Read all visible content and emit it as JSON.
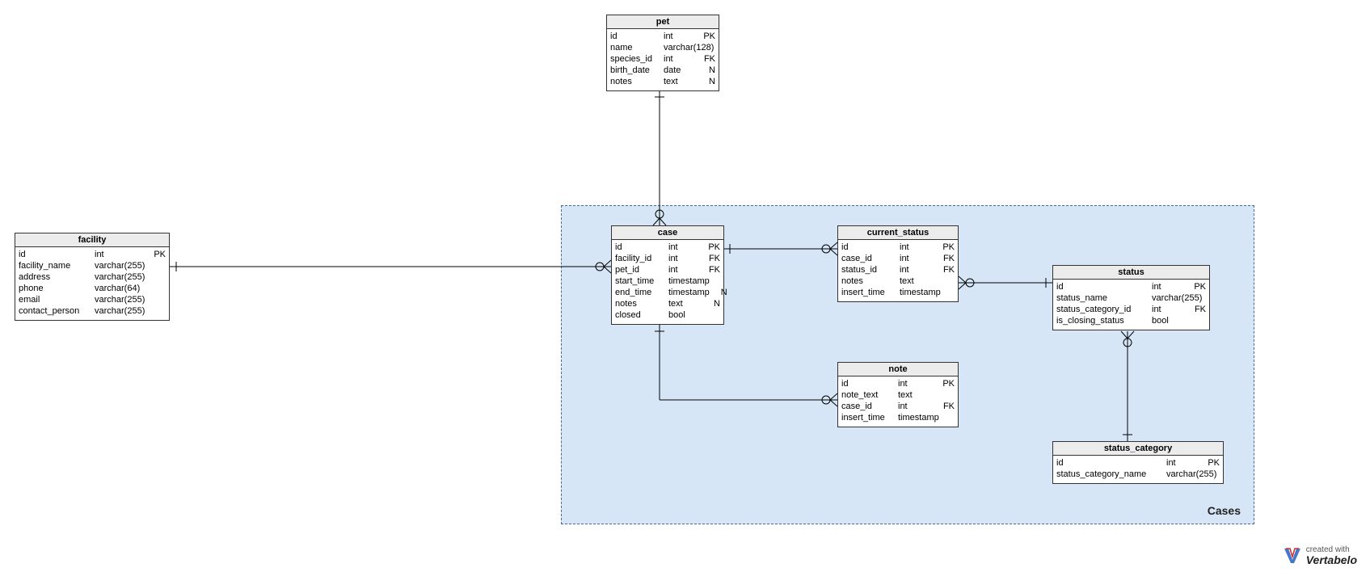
{
  "region": {
    "label": "Cases"
  },
  "entities": {
    "pet": {
      "title": "pet",
      "rows": [
        {
          "name": "id",
          "type": "int",
          "flag": "PK"
        },
        {
          "name": "name",
          "type": "varchar(128)",
          "flag": ""
        },
        {
          "name": "species_id",
          "type": "int",
          "flag": "FK"
        },
        {
          "name": "birth_date",
          "type": "date",
          "flag": "N"
        },
        {
          "name": "notes",
          "type": "text",
          "flag": "N"
        }
      ]
    },
    "facility": {
      "title": "facility",
      "rows": [
        {
          "name": "id",
          "type": "int",
          "flag": "PK"
        },
        {
          "name": "facility_name",
          "type": "varchar(255)",
          "flag": ""
        },
        {
          "name": "address",
          "type": "varchar(255)",
          "flag": ""
        },
        {
          "name": "phone",
          "type": "varchar(64)",
          "flag": ""
        },
        {
          "name": "email",
          "type": "varchar(255)",
          "flag": ""
        },
        {
          "name": "contact_person",
          "type": "varchar(255)",
          "flag": ""
        }
      ]
    },
    "case": {
      "title": "case",
      "rows": [
        {
          "name": "id",
          "type": "int",
          "flag": "PK"
        },
        {
          "name": "facility_id",
          "type": "int",
          "flag": "FK"
        },
        {
          "name": "pet_id",
          "type": "int",
          "flag": "FK"
        },
        {
          "name": "start_time",
          "type": "timestamp",
          "flag": ""
        },
        {
          "name": "end_time",
          "type": "timestamp",
          "flag": "N"
        },
        {
          "name": "notes",
          "type": "text",
          "flag": "N"
        },
        {
          "name": "closed",
          "type": "bool",
          "flag": ""
        }
      ]
    },
    "current_status": {
      "title": "current_status",
      "rows": [
        {
          "name": "id",
          "type": "int",
          "flag": "PK"
        },
        {
          "name": "case_id",
          "type": "int",
          "flag": "FK"
        },
        {
          "name": "status_id",
          "type": "int",
          "flag": "FK"
        },
        {
          "name": "notes",
          "type": "text",
          "flag": ""
        },
        {
          "name": "insert_time",
          "type": "timestamp",
          "flag": ""
        }
      ]
    },
    "status": {
      "title": "status",
      "rows": [
        {
          "name": "id",
          "type": "int",
          "flag": "PK"
        },
        {
          "name": "status_name",
          "type": "varchar(255)",
          "flag": ""
        },
        {
          "name": "status_category_id",
          "type": "int",
          "flag": "FK"
        },
        {
          "name": "is_closing_status",
          "type": "bool",
          "flag": ""
        }
      ]
    },
    "note": {
      "title": "note",
      "rows": [
        {
          "name": "id",
          "type": "int",
          "flag": "PK"
        },
        {
          "name": "note_text",
          "type": "text",
          "flag": ""
        },
        {
          "name": "case_id",
          "type": "int",
          "flag": "FK"
        },
        {
          "name": "insert_time",
          "type": "timestamp",
          "flag": ""
        }
      ]
    },
    "status_category": {
      "title": "status_category",
      "rows": [
        {
          "name": "id",
          "type": "int",
          "flag": "PK"
        },
        {
          "name": "status_category_name",
          "type": "varchar(255)",
          "flag": ""
        }
      ]
    }
  },
  "watermark": {
    "small": "created with",
    "brand": "Vertabelo"
  },
  "chart_data": {
    "type": "table",
    "diagram_type": "entity-relationship",
    "region": "Cases",
    "entities": [
      {
        "name": "pet",
        "columns": [
          {
            "name": "id",
            "type": "int",
            "key": "PK"
          },
          {
            "name": "name",
            "type": "varchar(128)"
          },
          {
            "name": "species_id",
            "type": "int",
            "key": "FK"
          },
          {
            "name": "birth_date",
            "type": "date",
            "nullable": true
          },
          {
            "name": "notes",
            "type": "text",
            "nullable": true
          }
        ]
      },
      {
        "name": "facility",
        "columns": [
          {
            "name": "id",
            "type": "int",
            "key": "PK"
          },
          {
            "name": "facility_name",
            "type": "varchar(255)"
          },
          {
            "name": "address",
            "type": "varchar(255)"
          },
          {
            "name": "phone",
            "type": "varchar(64)"
          },
          {
            "name": "email",
            "type": "varchar(255)"
          },
          {
            "name": "contact_person",
            "type": "varchar(255)"
          }
        ]
      },
      {
        "name": "case",
        "columns": [
          {
            "name": "id",
            "type": "int",
            "key": "PK"
          },
          {
            "name": "facility_id",
            "type": "int",
            "key": "FK"
          },
          {
            "name": "pet_id",
            "type": "int",
            "key": "FK"
          },
          {
            "name": "start_time",
            "type": "timestamp"
          },
          {
            "name": "end_time",
            "type": "timestamp",
            "nullable": true
          },
          {
            "name": "notes",
            "type": "text",
            "nullable": true
          },
          {
            "name": "closed",
            "type": "bool"
          }
        ]
      },
      {
        "name": "current_status",
        "columns": [
          {
            "name": "id",
            "type": "int",
            "key": "PK"
          },
          {
            "name": "case_id",
            "type": "int",
            "key": "FK"
          },
          {
            "name": "status_id",
            "type": "int",
            "key": "FK"
          },
          {
            "name": "notes",
            "type": "text"
          },
          {
            "name": "insert_time",
            "type": "timestamp"
          }
        ]
      },
      {
        "name": "status",
        "columns": [
          {
            "name": "id",
            "type": "int",
            "key": "PK"
          },
          {
            "name": "status_name",
            "type": "varchar(255)"
          },
          {
            "name": "status_category_id",
            "type": "int",
            "key": "FK"
          },
          {
            "name": "is_closing_status",
            "type": "bool"
          }
        ]
      },
      {
        "name": "note",
        "columns": [
          {
            "name": "id",
            "type": "int",
            "key": "PK"
          },
          {
            "name": "note_text",
            "type": "text"
          },
          {
            "name": "case_id",
            "type": "int",
            "key": "FK"
          },
          {
            "name": "insert_time",
            "type": "timestamp"
          }
        ]
      },
      {
        "name": "status_category",
        "columns": [
          {
            "name": "id",
            "type": "int",
            "key": "PK"
          },
          {
            "name": "status_category_name",
            "type": "varchar(255)"
          }
        ]
      }
    ],
    "relationships": [
      {
        "from": "pet",
        "to": "case",
        "cardinality": "one-to-many"
      },
      {
        "from": "facility",
        "to": "case",
        "cardinality": "one-to-many"
      },
      {
        "from": "case",
        "to": "current_status",
        "cardinality": "one-to-many"
      },
      {
        "from": "case",
        "to": "note",
        "cardinality": "one-to-many"
      },
      {
        "from": "status",
        "to": "current_status",
        "cardinality": "one-to-many"
      },
      {
        "from": "status_category",
        "to": "status",
        "cardinality": "one-to-many"
      }
    ]
  }
}
